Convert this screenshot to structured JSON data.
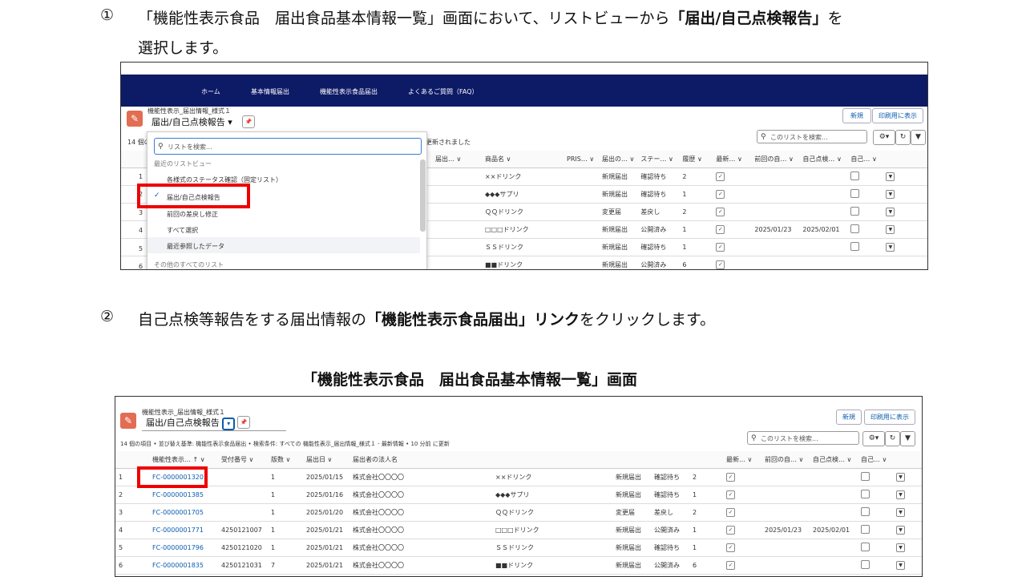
{
  "step1": {
    "num": "①",
    "line1_pre": "「機能性表示食品　届出食品基本情報一覧」画面において、リストビューから",
    "line1_bold": "「届出/自己点検報告」",
    "line1_post": "を",
    "line2": "選択します。"
  },
  "step2": {
    "num": "②",
    "pre": "自己点検等報告をする届出情報の",
    "bold": "「機能性表示食品届出」リンク",
    "post": "をクリックします。"
  },
  "mid_title": "「機能性表示食品　届出食品基本情報一覧」画面",
  "nav": {
    "items": [
      "ホーム",
      "基本情報届出",
      "機能性表示食品届出",
      "よくあるご質問（FAQ）"
    ]
  },
  "list": {
    "object_label": "機能性表示_届出情報_様式１",
    "view_name": "届出/自己点検報告",
    "count_short": "14 個の",
    "updated": "更新されました",
    "info": "14 個の項目 • 並び替え基準: 機能性表示食品届出 • 検索条件: すべての 機能性表示_届出情報_様式１ - 最新情報 • 10 分前 に更新",
    "btn_new": "新規",
    "btn_print": "印刷用に表示",
    "search_placeholder": "このリストを検索...",
    "gear": "⚙▾",
    "refresh": "↻",
    "filter": "▼"
  },
  "dropdown": {
    "search_placeholder": "リストを検索...",
    "recent_header": "最近のリストビュー",
    "items": [
      "各様式のステータス確認（固定リスト）",
      "届出/自己点検報告",
      "前回の差戻し修正",
      "すべて選択",
      "最近参照したデータ"
    ],
    "check": "✓",
    "other_header": "その他のすべてのリスト"
  },
  "headers1": [
    "届出… ∨",
    "商品名 ∨",
    "PRIS… ∨",
    "届出の… ∨",
    "ステー… ∨",
    "履歴 ∨",
    "最新… ∨",
    "前回の自… ∨",
    "自己点検… ∨",
    "自己… ∨"
  ],
  "headers2": [
    "機能性表示… ↑ ∨",
    "受付番号 ∨",
    "版数 ∨",
    "届出日 ∨",
    "届出者の法人名",
    "最新… ∨",
    "前回の自… ∨",
    "自己点検… ∨",
    "自己… ∨"
  ],
  "rows": [
    {
      "no": "1",
      "id": "FC-0000001320",
      "rcpt": "",
      "ver": "1",
      "date": "2025/01/15",
      "corp": "株式会社〇〇〇〇",
      "name": "××ドリンク",
      "type": "新規届出",
      "status": "確認待ち",
      "hist": "2",
      "prev": "",
      "next": ""
    },
    {
      "no": "2",
      "id": "FC-0000001385",
      "rcpt": "",
      "ver": "1",
      "date": "2025/01/16",
      "corp": "株式会社〇〇〇〇",
      "name": "◆◆◆サプリ",
      "type": "新規届出",
      "status": "確認待ち",
      "hist": "1",
      "prev": "",
      "next": ""
    },
    {
      "no": "3",
      "id": "FC-0000001705",
      "rcpt": "",
      "ver": "1",
      "date": "2025/01/20",
      "corp": "株式会社〇〇〇〇",
      "name": "ＱＱドリンク",
      "type": "変更届",
      "status": "差戻し",
      "hist": "2",
      "prev": "",
      "next": ""
    },
    {
      "no": "4",
      "id": "FC-0000001771",
      "rcpt": "4250121007",
      "ver": "1",
      "date": "2025/01/21",
      "corp": "株式会社〇〇〇〇",
      "name": "□□□ドリンク",
      "type": "新規届出",
      "status": "公開済み",
      "hist": "1",
      "prev": "2025/01/23",
      "next": "2025/02/01"
    },
    {
      "no": "5",
      "id": "FC-0000001796",
      "rcpt": "4250121020",
      "ver": "1",
      "date": "2025/01/21",
      "corp": "株式会社〇〇〇〇",
      "name": "ＳＳドリンク",
      "type": "新規届出",
      "status": "確認待ち",
      "hist": "1",
      "prev": "",
      "next": ""
    },
    {
      "no": "6",
      "id": "FC-0000001835",
      "rcpt": "4250121031",
      "ver": "7",
      "date": "2025/01/21",
      "corp": "株式会社〇〇〇〇",
      "name": "■■ドリンク",
      "type": "新規届出",
      "status": "公開済み",
      "hist": "6",
      "prev": "",
      "next": ""
    }
  ],
  "cells": {
    "check": "✓",
    "dropdown": "▼",
    "pin": "📌",
    "caret": "▾",
    "pencil": "✎"
  }
}
